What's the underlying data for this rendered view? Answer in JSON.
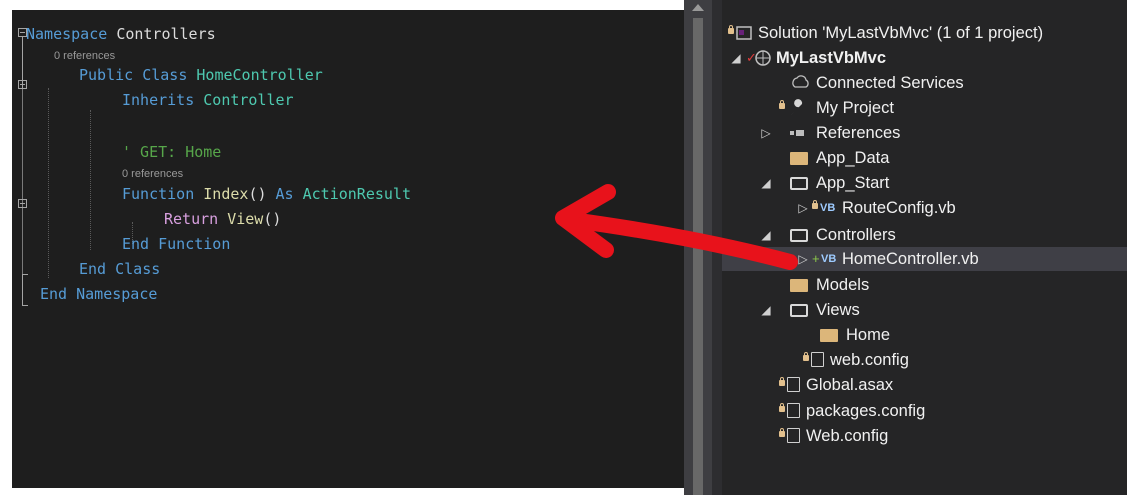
{
  "editor": {
    "lines": {
      "l1": {
        "kw": "Namespace",
        "name": "Controllers"
      },
      "lens1": "0 references",
      "l2": {
        "kw1": "Public",
        "kw2": "Class",
        "name": "HomeController"
      },
      "l3": {
        "kw": "Inherits",
        "name": "Controller"
      },
      "l4": {
        "comment": "' GET: Home"
      },
      "lens2": "0 references",
      "l5": {
        "kw1": "Function",
        "name": "Index",
        "paren": "()",
        "kw2": "As",
        "type": "ActionResult"
      },
      "l6": {
        "kw": "Return",
        "name": "View",
        "paren": "()"
      },
      "l7": {
        "kw1": "End",
        "kw2": "Function"
      },
      "l8": {
        "kw1": "End",
        "kw2": "Class"
      },
      "l9": {
        "kw1": "End",
        "kw2": "Namespace"
      }
    }
  },
  "explorer": {
    "nodes": [
      {
        "label": "Solution 'MyLastVbMvc' (1 of 1 project)",
        "icon": "solution-icon"
      },
      {
        "label": "MyLastVbMvc",
        "icon": "web-project-icon"
      },
      {
        "label": "Connected Services",
        "icon": "connected-services-icon"
      },
      {
        "label": "My Project",
        "icon": "wrench-icon"
      },
      {
        "label": "References",
        "icon": "references-icon"
      },
      {
        "label": "App_Data",
        "icon": "folder-icon"
      },
      {
        "label": "App_Start",
        "icon": "folder-open-icon"
      },
      {
        "label": "RouteConfig.vb",
        "icon": "vb-file-icon"
      },
      {
        "label": "Controllers",
        "icon": "folder-open-icon"
      },
      {
        "label": "HomeController.vb",
        "icon": "vb-file-icon"
      },
      {
        "label": "Models",
        "icon": "folder-icon"
      },
      {
        "label": "Views",
        "icon": "folder-open-icon"
      },
      {
        "label": "Home",
        "icon": "folder-icon"
      },
      {
        "label": "web.config",
        "icon": "config-file-icon"
      },
      {
        "label": "Global.asax",
        "icon": "asax-file-icon"
      },
      {
        "label": "packages.config",
        "icon": "config-file-icon"
      },
      {
        "label": "Web.config",
        "icon": "config-file-icon"
      }
    ],
    "vb_badge": "VB",
    "expander_collapsed": "▷",
    "expander_expanded": "◢"
  },
  "annotation": {
    "color": "#e8121b",
    "icon": "red-arrow-annotation"
  }
}
